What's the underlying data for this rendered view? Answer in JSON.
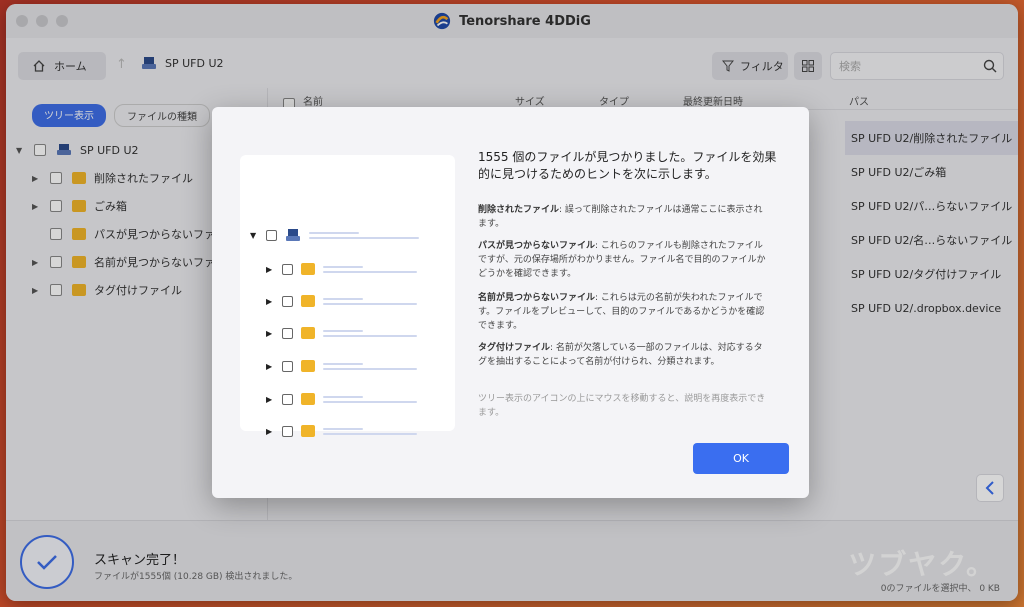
{
  "app": {
    "title": "Tenorshare 4DDiG"
  },
  "toolbar": {
    "home_label": "ホーム",
    "drive_label": "SP UFD U2",
    "filter_label": "フィルタ",
    "search_placeholder": "検索"
  },
  "sidebar": {
    "tab_tree": "ツリー表示",
    "tab_type": "ファイルの種類",
    "root": "SP UFD U2",
    "items": [
      {
        "label": "削除されたファイル"
      },
      {
        "label": "ごみ箱"
      },
      {
        "label": "パスが見つからないファイ"
      },
      {
        "label": "名前が見つからないファイ"
      },
      {
        "label": "タグ付けファイル"
      }
    ]
  },
  "filelist": {
    "columns": {
      "name": "名前",
      "size": "サイズ",
      "type": "タイプ",
      "modified": "最終更新日時",
      "path": "パス"
    },
    "paths": [
      "SP UFD U2/削除されたファイル",
      "SP UFD U2/ごみ箱",
      "SP UFD U2/パ…らないファイル",
      "SP UFD U2/名…らないファイル",
      "SP UFD U2/タグ付けファイル",
      "SP UFD U2/.dropbox.device"
    ]
  },
  "status": {
    "title": "スキャン完了！",
    "subtitle": "ファイルが1555個 (10.28 GB) 検出されました。",
    "selection": "0のファイルを選択中、 0 KB",
    "watermark": "ツブヤク。"
  },
  "modal": {
    "title": "1555 個のファイルが見つかりました。ファイルを効果的に見つけるためのヒントを次に示します。",
    "tips": [
      {
        "term": "削除されたファイル",
        "text": ": 誤って削除されたファイルは通常ここに表示されます。"
      },
      {
        "term": "パスが見つからないファイル",
        "text": ": これらのファイルも削除されたファイルですが、元の保存場所がわかりません。ファイル名で目的のファイルかどうかを確認できます。"
      },
      {
        "term": "名前が見つからないファイル",
        "text": ": これらは元の名前が失われたファイルです。ファイルをプレビューして、目的のファイルであるかどうかを確認できます。"
      },
      {
        "term": "タグ付けファイル",
        "text": ": 名前が欠落している一部のファイルは、対応するタグを抽出することによって名前が付けられ、分類されます。"
      }
    ],
    "hint": "ツリー表示のアイコンの上にマウスを移動すると、説明を再度表示できます。",
    "ok_label": "OK"
  },
  "colors": {
    "accent": "#3a6ef0",
    "folder": "#f0b429"
  }
}
